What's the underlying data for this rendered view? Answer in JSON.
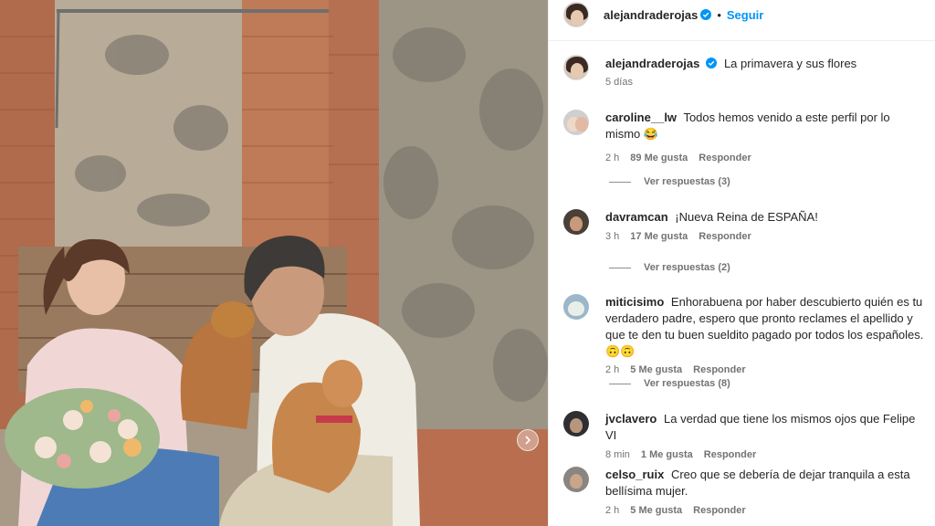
{
  "post": {
    "author": "alejandraderojas",
    "follow_label": "Seguir",
    "separator": "•",
    "caption": "La primavera y sus flores",
    "caption_time": "5 días"
  },
  "comments": [
    {
      "user": "caroline__lw",
      "text": "Todos hemos venido a este perfil por lo mismo",
      "emoji": "😂",
      "time": "2 h",
      "likes": "89 Me gusta",
      "reply": "Responder",
      "replies": "Ver respuestas (3)"
    },
    {
      "user": "davramcan",
      "text": "¡Nueva Reina de ESPAÑA!",
      "emoji": "",
      "time": "3 h",
      "likes": "17 Me gusta",
      "reply": "Responder",
      "replies": "Ver respuestas (2)"
    },
    {
      "user": "miticisimo",
      "text": "Enhorabuena por haber descubierto quién es tu verdadero padre, espero que pronto reclames el apellido y que te den tu buen sueldito pagado por todos los españoles.",
      "emoji": "🙃🙃",
      "time": "2 h",
      "likes": "5 Me gusta",
      "reply": "Responder",
      "replies": "Ver respuestas (8)"
    },
    {
      "user": "jvclavero",
      "text": "La verdad que tiene los mismos ojos que Felipe VI",
      "emoji": "",
      "time": "8 min",
      "likes": "1 Me gusta",
      "reply": "Responder",
      "replies": ""
    },
    {
      "user": "celso_ruix",
      "text": "Creo que se debería de dejar tranquila a esta bellísima mujer.",
      "emoji": "",
      "time": "2 h",
      "likes": "5 Me gusta",
      "reply": "Responder",
      "replies": ""
    }
  ],
  "colors": {
    "accent": "#0095f6",
    "verified": "#0095f6",
    "muted": "#737373"
  },
  "icons": {
    "verified": "verified-badge-icon",
    "carousel": "chevron-right-icon"
  }
}
